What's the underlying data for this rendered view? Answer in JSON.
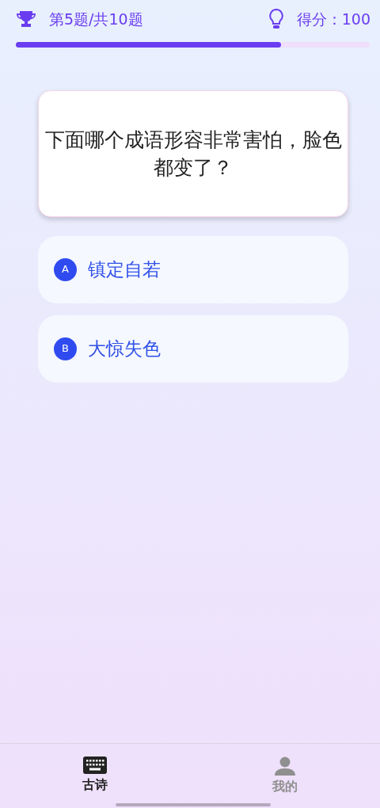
{
  "header": {
    "progress_text": "第5题/共10题",
    "score_text": "得分：100"
  },
  "progress": {
    "level": 0.75
  },
  "question": {
    "text": "下面哪个成语形容非常害怕，脸色都变了？"
  },
  "options": [
    {
      "letter": "A",
      "text": "镇定自若"
    },
    {
      "letter": "B",
      "text": "大惊失色"
    }
  ],
  "tabs": [
    {
      "label": "古诗",
      "kind": "keyboard",
      "selected": true
    },
    {
      "label": "我的",
      "kind": "person",
      "selected": false
    }
  ]
}
